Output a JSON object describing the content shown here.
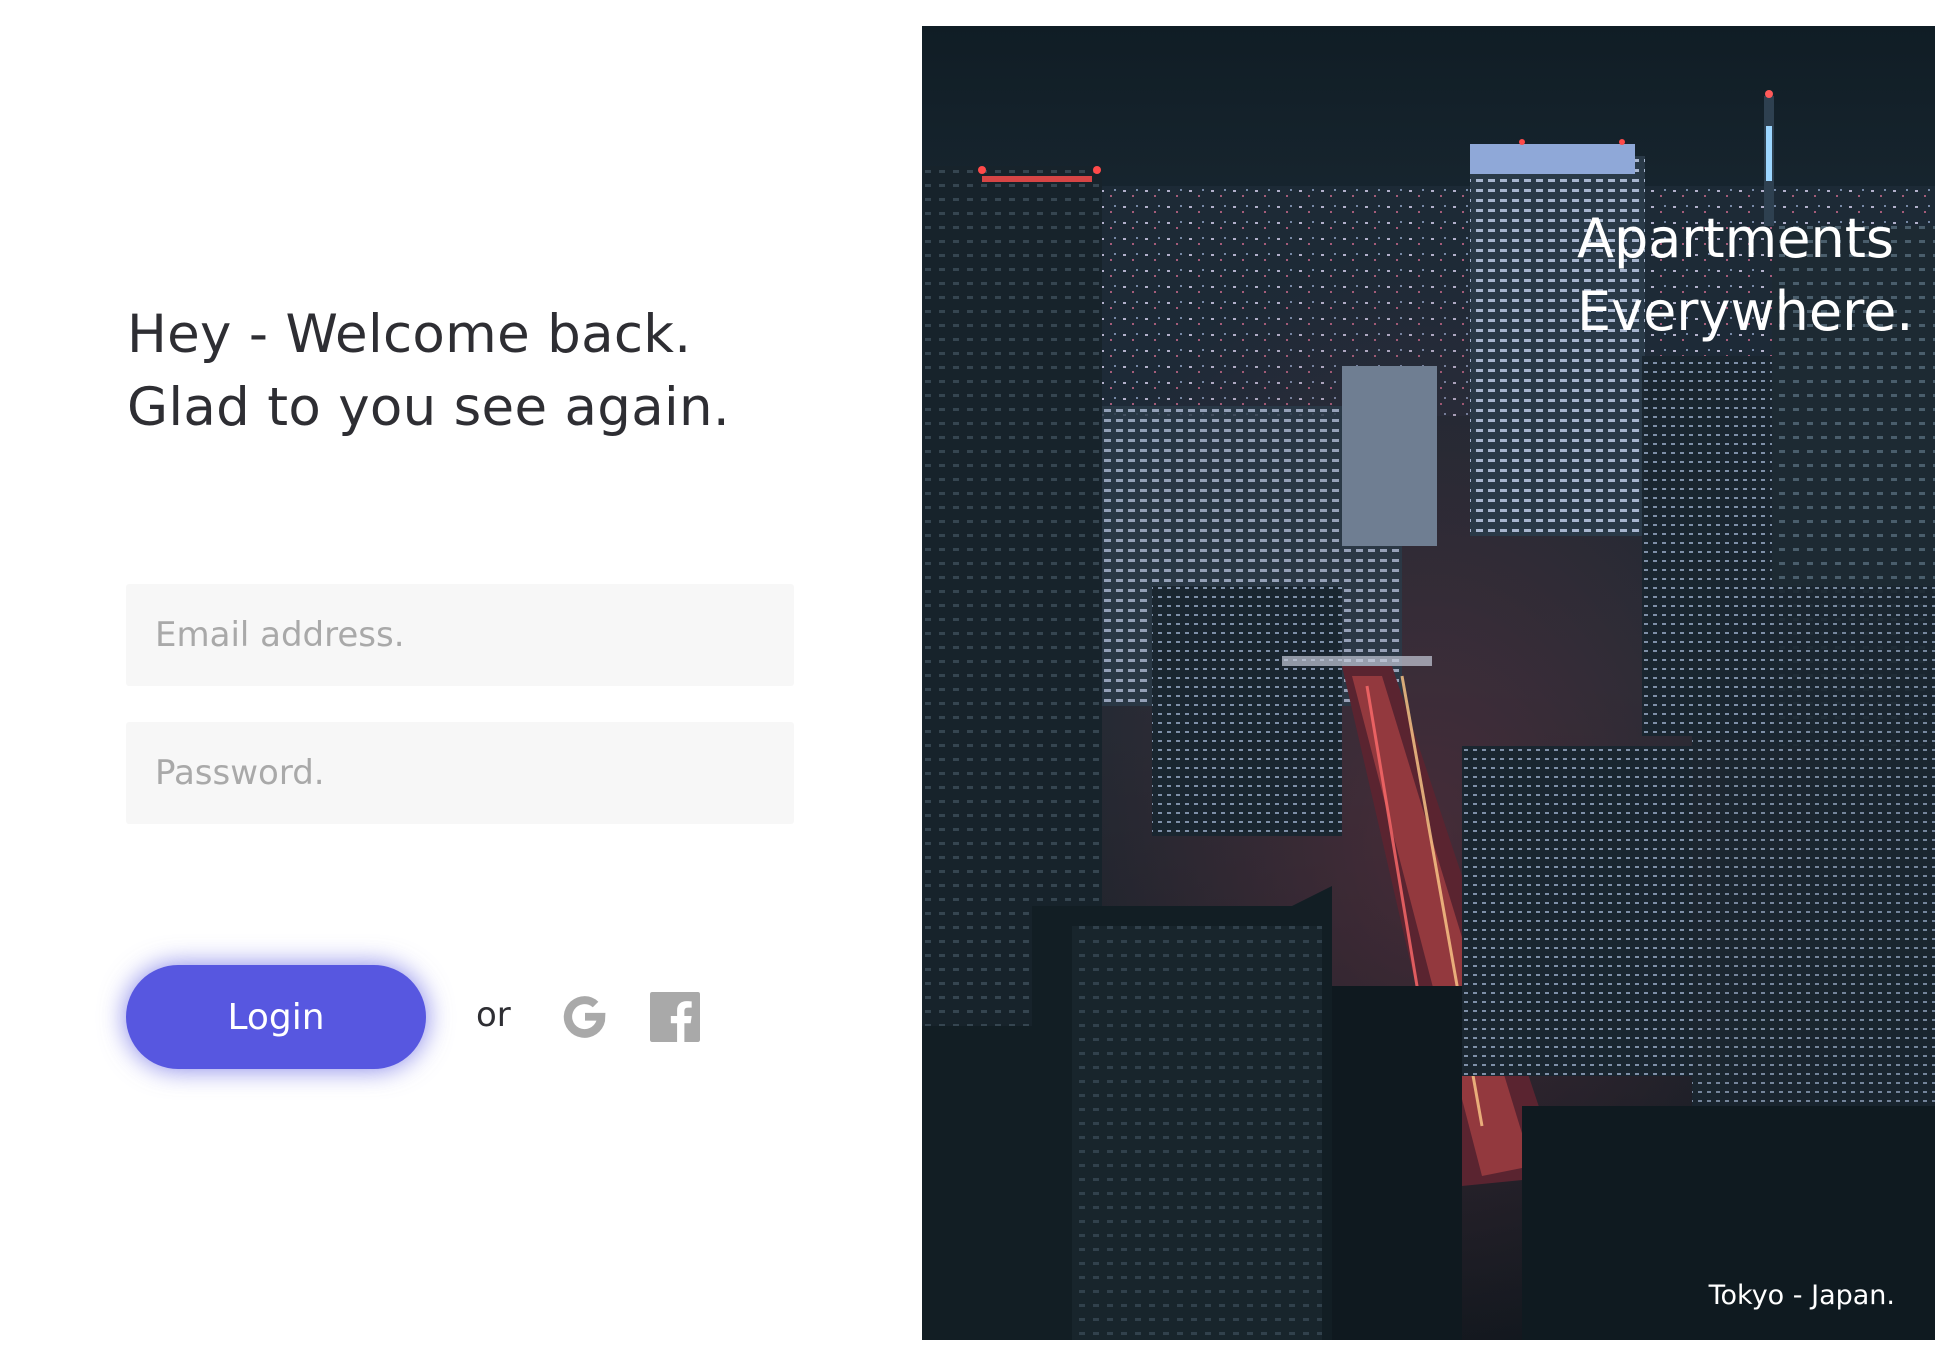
{
  "welcome": {
    "line1": "Hey - Welcome back.",
    "line2": "Glad to you see again."
  },
  "form": {
    "email_placeholder": "Email address.",
    "password_placeholder": "Password."
  },
  "actions": {
    "login_label": "Login",
    "or_label": "or",
    "social": [
      "google-icon",
      "facebook-icon"
    ]
  },
  "hero": {
    "title_line1": "Apartments",
    "title_line2": "Everywhere.",
    "caption": "Tokyo - Japan."
  },
  "colors": {
    "accent": "#5757e0",
    "text": "#2e2e33",
    "field_bg": "#f7f7f7",
    "icon": "#a9a9a9"
  }
}
